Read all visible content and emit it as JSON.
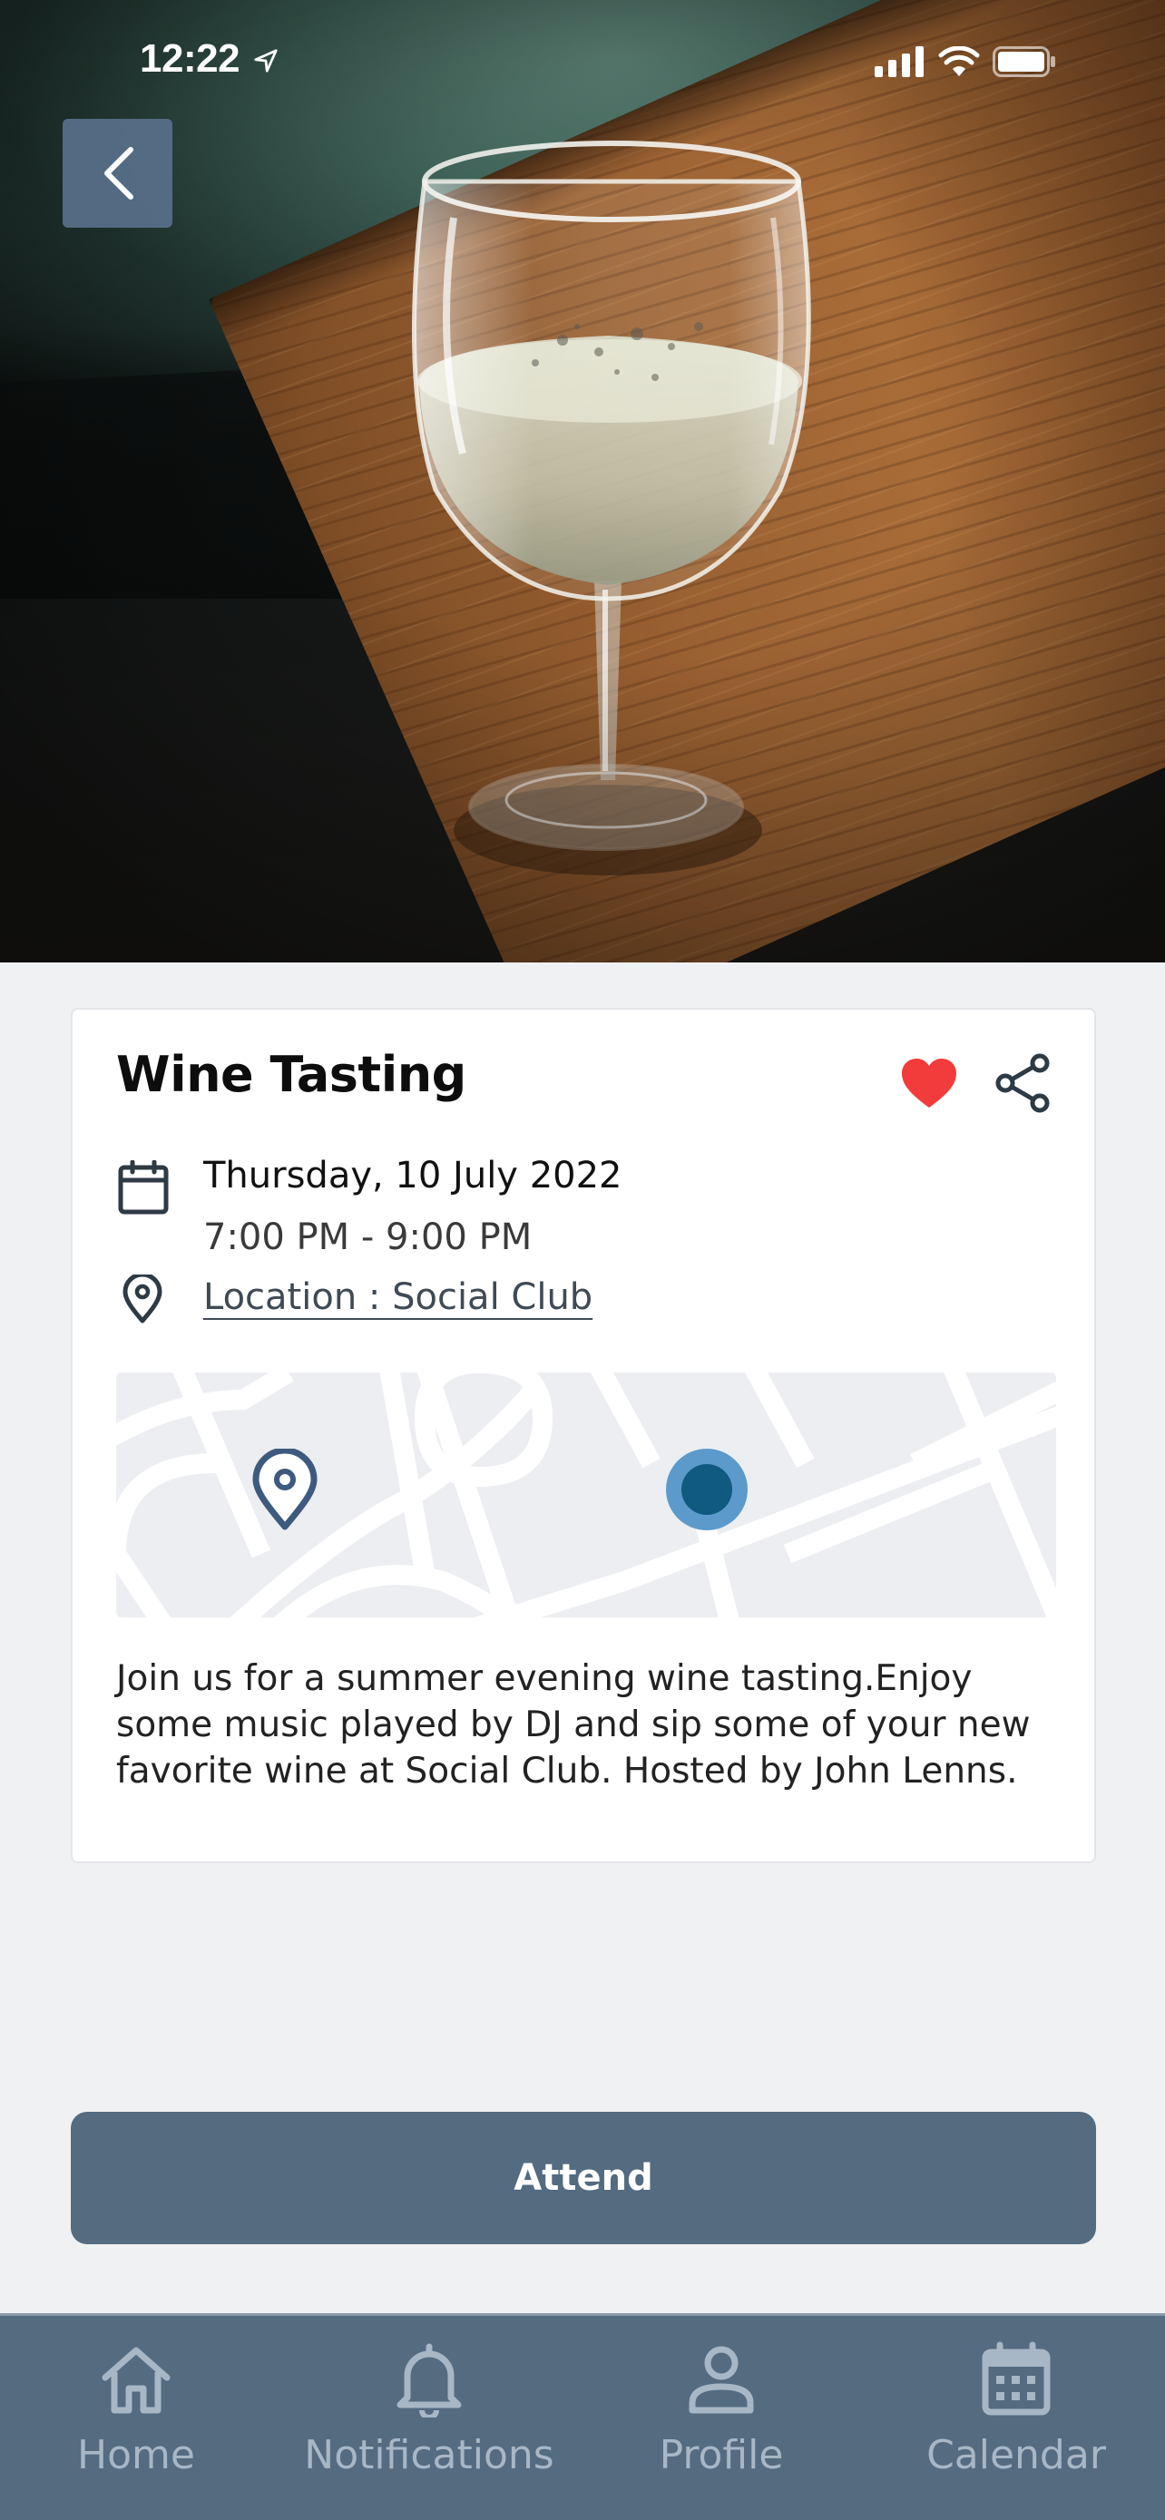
{
  "status_bar": {
    "time": "12:22"
  },
  "event": {
    "title": "Wine Tasting",
    "date": "Thursday, 10 July 2022",
    "time": "7:00 PM - 9:00 PM",
    "location": "Location : Social Club",
    "description": "Join us for a summer evening wine tasting.Enjoy some music played by DJ and sip some of your new favorite wine at Social Club. Hosted by John Lenns.",
    "favorited": true
  },
  "actions": {
    "attend_label": "Attend"
  },
  "tabs": [
    {
      "label": "Home",
      "icon": "home-icon"
    },
    {
      "label": "Notifications",
      "icon": "bell-icon"
    },
    {
      "label": "Profile",
      "icon": "person-icon"
    },
    {
      "label": "Calendar",
      "icon": "calendar-icon"
    }
  ],
  "colors": {
    "primary": "#546b80",
    "heart": "#f23b3b",
    "tab_label": "#a8b7c5",
    "map_marker_fill": "#0f5a7e",
    "map_marker_ring": "#5b9acb",
    "map_pin": "#3e5a7e"
  }
}
